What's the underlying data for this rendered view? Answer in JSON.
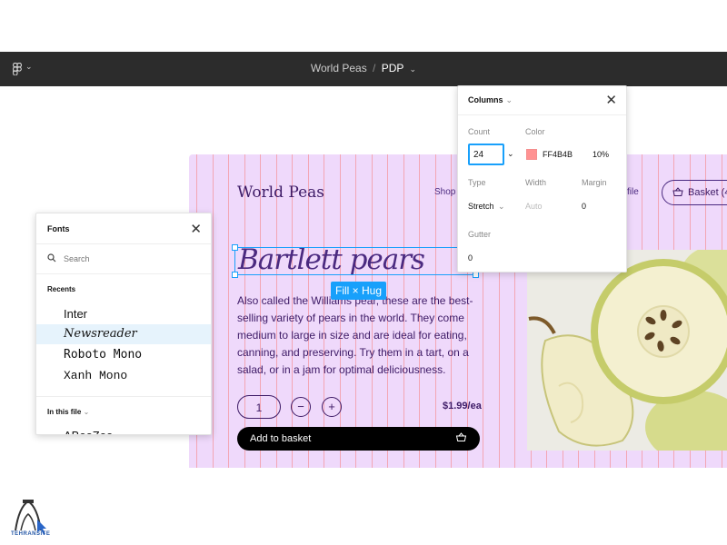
{
  "topbar": {
    "file_name": "World Peas",
    "separator": "/",
    "page_name": "PDP",
    "caret": "⌄"
  },
  "site": {
    "brand": "World Peas",
    "nav_shop": "Shop",
    "nav_file": "file",
    "basket_label": "Basket (4",
    "heading": "Bartlett pears",
    "description": "Also called the Williams pear, these are the best-selling variety of pears in the world. They come medium to large in size and are ideal for eating, canning, and preserving. Try them in a tart, on a salad, or in a jam for optimal deliciousness.",
    "quantity": "1",
    "minus": "−",
    "plus": "+",
    "price": "$1.99/ea",
    "add_to_basket": "Add to basket"
  },
  "selection": {
    "badge": "Fill × Hug"
  },
  "columns_panel": {
    "title": "Columns",
    "count_label": "Count",
    "count_value": "24",
    "color_label": "Color",
    "color_hex": "FF4B4B",
    "color_opacity": "10%",
    "type_label": "Type",
    "type_value": "Stretch",
    "width_label": "Width",
    "width_value": "Auto",
    "margin_label": "Margin",
    "margin_value": "0",
    "gutter_label": "Gutter",
    "gutter_value": "0",
    "swatch_color": "#ff4b4b"
  },
  "fonts_panel": {
    "title": "Fonts",
    "search_placeholder": "Search",
    "recents_label": "Recents",
    "recents": [
      "Inter",
      "Newsreader",
      "Roboto Mono",
      "Xanh Mono"
    ],
    "selected_font": "Newsreader",
    "in_this_file_label": "In this file",
    "partial_item": "ABeeZee"
  },
  "watermark": {
    "text": "TEHRANSITE"
  },
  "colors": {
    "accent": "#18a0fb",
    "frame_bg": "#efd9fb",
    "grid_line": "#f3a6b4",
    "brand_text": "#3d1a66"
  }
}
